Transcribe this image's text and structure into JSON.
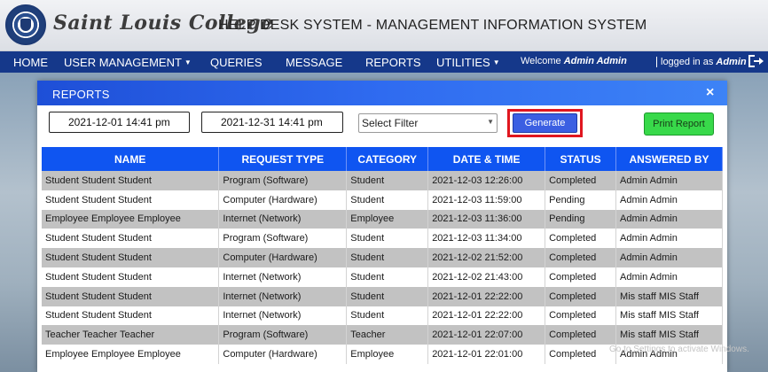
{
  "header": {
    "college_name": "Saint Louis College",
    "system_title": "HELP DESK SYSTEM - MANAGEMENT INFORMATION SYSTEM"
  },
  "nav": {
    "items": [
      {
        "label": "HOME"
      },
      {
        "label": "USER MANAGEMENT"
      },
      {
        "label": "QUERIES"
      },
      {
        "label": "MESSAGE"
      },
      {
        "label": "REPORTS"
      },
      {
        "label": "UTILITIES"
      }
    ],
    "welcome_prefix": "Welcome",
    "welcome_name": "Admin Admin",
    "logged_prefix": "logged in as",
    "logged_user": "Admin",
    "logout_icon": "logout-icon"
  },
  "modal": {
    "title": "REPORTS",
    "close": "×",
    "date_from": "2021-12-01 14:41 pm",
    "date_to": "2021-12-31 14:41 pm",
    "filter_selected": "Select Filter",
    "generate_label": "Generate",
    "print_label": "Print Report"
  },
  "table": {
    "headers": [
      "NAME",
      "REQUEST TYPE",
      "CATEGORY",
      "DATE & TIME",
      "STATUS",
      "ANSWERED BY"
    ],
    "rows": [
      [
        "Student Student Student",
        "Program (Software)",
        "Student",
        "2021-12-03 12:26:00",
        "Completed",
        "Admin Admin"
      ],
      [
        "Student Student Student",
        "Computer (Hardware)",
        "Student",
        "2021-12-03 11:59:00",
        "Pending",
        "Admin Admin"
      ],
      [
        "Employee Employee Employee",
        "Internet (Network)",
        "Employee",
        "2021-12-03 11:36:00",
        "Pending",
        "Admin Admin"
      ],
      [
        "Student Student Student",
        "Program (Software)",
        "Student",
        "2021-12-03 11:34:00",
        "Completed",
        "Admin Admin"
      ],
      [
        "Student Student Student",
        "Computer (Hardware)",
        "Student",
        "2021-12-02 21:52:00",
        "Completed",
        "Admin Admin"
      ],
      [
        "Student Student Student",
        "Internet (Network)",
        "Student",
        "2021-12-02 21:43:00",
        "Completed",
        "Admin Admin"
      ],
      [
        "Student Student Student",
        "Internet (Network)",
        "Student",
        "2021-12-01 22:22:00",
        "Completed",
        "Mis staff MIS Staff"
      ],
      [
        "Student Student Student",
        "Internet (Network)",
        "Student",
        "2021-12-01 22:22:00",
        "Completed",
        "Mis staff MIS Staff"
      ],
      [
        "Teacher Teacher Teacher",
        "Program (Software)",
        "Teacher",
        "2021-12-01 22:07:00",
        "Completed",
        "Mis staff MIS Staff"
      ],
      [
        "Employee Employee Employee",
        "Computer (Hardware)",
        "Employee",
        "2021-12-01 22:01:00",
        "Completed",
        "Admin Admin"
      ]
    ]
  },
  "watermark": "Go to Settings to activate Windows."
}
